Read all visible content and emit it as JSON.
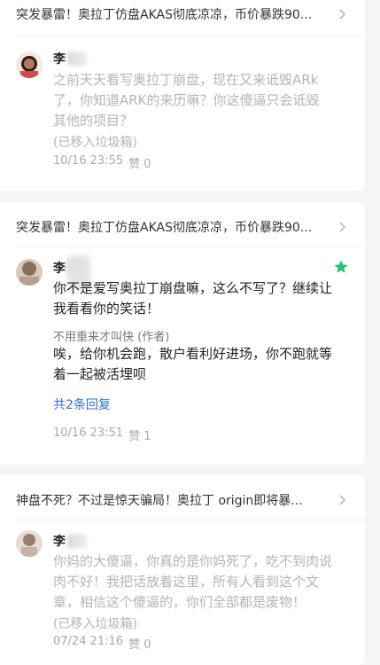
{
  "comments": [
    {
      "article_title": "突发暴雷！奥拉丁仿盘AKAS彻底凉凉，币价暴跌90...",
      "user_name": "李",
      "content_lines": [
        "之前天天看写奥拉丁崩盘，现在又来诋毁ARk",
        "了，你知道ARK的来历嘛？你这傻逼只会诋毁",
        "其他的项目？"
      ],
      "status": "(已移入垃圾箱)",
      "date": "10/16 23:55",
      "likes_label": "赞 0"
    },
    {
      "article_title": "突发暴雷！奥拉丁仿盘AKAS彻底凉凉，币价暴跌90...",
      "user_name": "李",
      "content_lines": [
        "你不是爱写奥拉丁崩盘嘛，这么不写了？继续让",
        "我看看你的笑话！"
      ],
      "reply_author": "不用重来才叫快 (作者)",
      "reply_lines": [
        "唉，给你机会跑，散户看利好进场，你不跑就等",
        "着一起被活埋呗"
      ],
      "reply_link": "共2条回复",
      "date": "10/16 23:51",
      "likes_label": "赞 1"
    },
    {
      "article_title": "神盘不死？不过是惊天骗局！奥拉丁 origin即将暴...",
      "user_name": "李",
      "content_lines": [
        "你妈的大傻逼，你真的是你妈死了，吃不到肉说",
        "肉不好！我把话放着这里，所有人看到这个文",
        "章，相信这个傻逼的，你们全部都是废物！"
      ],
      "status": "(已移入垃圾箱)",
      "date": "07/24 21:16",
      "likes_label": "赞 0"
    }
  ],
  "colors": {
    "accent_green": "#1fc37a",
    "link_blue": "#2e6fe0",
    "gray_text": "#b4b4b4"
  }
}
